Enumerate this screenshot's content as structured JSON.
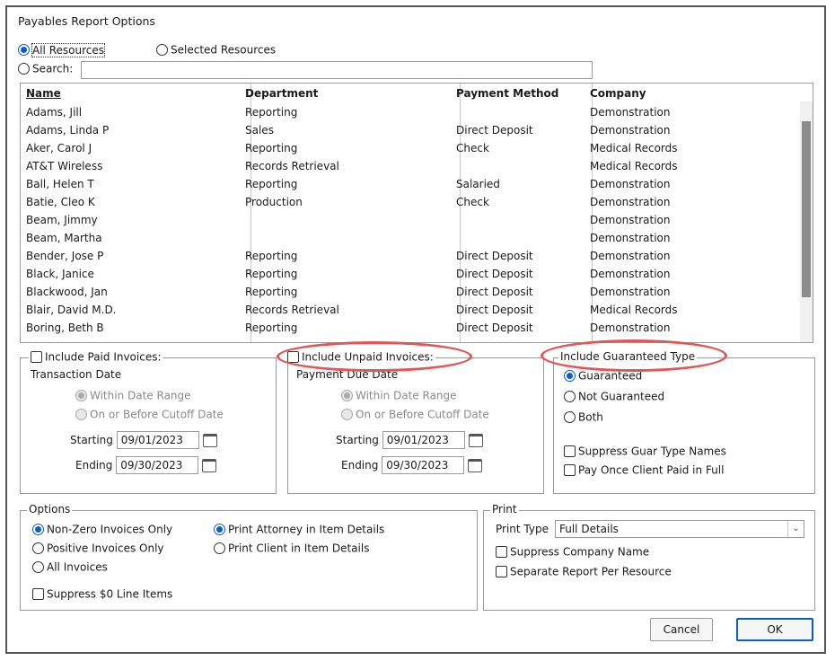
{
  "window": {
    "title": "Payables Report Options"
  },
  "resources": {
    "all_label": "All Resources",
    "selected_label": "Selected Resources",
    "search_label": "Search:",
    "search_value": ""
  },
  "table": {
    "columns": [
      "Name",
      "Department",
      "Payment Method",
      "Company"
    ],
    "rows": [
      [
        "Adams, Jill",
        "Reporting",
        "",
        "Demonstration"
      ],
      [
        "Adams, Linda P",
        "Sales",
        "Direct Deposit",
        "Demonstration"
      ],
      [
        "Aker, Carol J",
        "Reporting",
        "Check",
        "Medical Records"
      ],
      [
        "AT&T Wireless",
        "Records Retrieval",
        "",
        "Medical Records"
      ],
      [
        "Ball, Helen T",
        "Reporting",
        "Salaried",
        "Demonstration"
      ],
      [
        "Batie, Cleo K",
        "Production",
        "Check",
        "Demonstration"
      ],
      [
        "Beam, Jimmy",
        "",
        "",
        "Demonstration"
      ],
      [
        "Beam, Martha",
        "",
        "",
        "Demonstration"
      ],
      [
        "Bender, Jose P",
        "Reporting",
        "Direct Deposit",
        "Demonstration"
      ],
      [
        "Black, Janice",
        "Reporting",
        "Direct Deposit",
        "Demonstration"
      ],
      [
        "Blackwood, Jan",
        "Reporting",
        "Direct Deposit",
        "Demonstration"
      ],
      [
        "Blair, David M.D.",
        "Records Retrieval",
        "Direct Deposit",
        "Medical Records"
      ],
      [
        "Boring, Beth B",
        "Reporting",
        "Direct Deposit",
        "Demonstration"
      ]
    ]
  },
  "paid": {
    "title": "Include Paid Invoices:",
    "subtitle": "Transaction Date",
    "within": "Within Date Range",
    "on_before": "On or Before Cutoff Date",
    "starting_label": "Starting",
    "starting_value": "09/01/2023",
    "ending_label": "Ending",
    "ending_value": "09/30/2023"
  },
  "unpaid": {
    "title": "Include Unpaid Invoices:",
    "subtitle": "Payment Due Date",
    "within": "Within Date Range",
    "on_before": "On or Before Cutoff Date",
    "starting_label": "Starting",
    "starting_value": "09/01/2023",
    "ending_label": "Ending",
    "ending_value": "09/30/2023"
  },
  "guar": {
    "title": "Include Guaranteed Type",
    "guaranteed": "Guaranteed",
    "not_guaranteed": "Not Guaranteed",
    "both": "Both",
    "suppress": "Suppress Guar Type Names",
    "pay_once": "Pay Once Client Paid in Full"
  },
  "options": {
    "title": "Options",
    "non_zero": "Non-Zero Invoices Only",
    "positive": "Positive Invoices Only",
    "all": "All Invoices",
    "suppress_zero": "Suppress $0 Line Items",
    "print_attorney": "Print Attorney in Item Details",
    "print_client": "Print Client in Item Details"
  },
  "print": {
    "title": "Print",
    "type_label": "Print Type",
    "type_value": "Full Details",
    "suppress_company": "Suppress Company Name",
    "separate": "Separate Report Per Resource"
  },
  "buttons": {
    "cancel": "Cancel",
    "ok": "OK"
  },
  "colors": {
    "accent": "#0a5fc7",
    "highlight_ellipse": "#e05555"
  }
}
